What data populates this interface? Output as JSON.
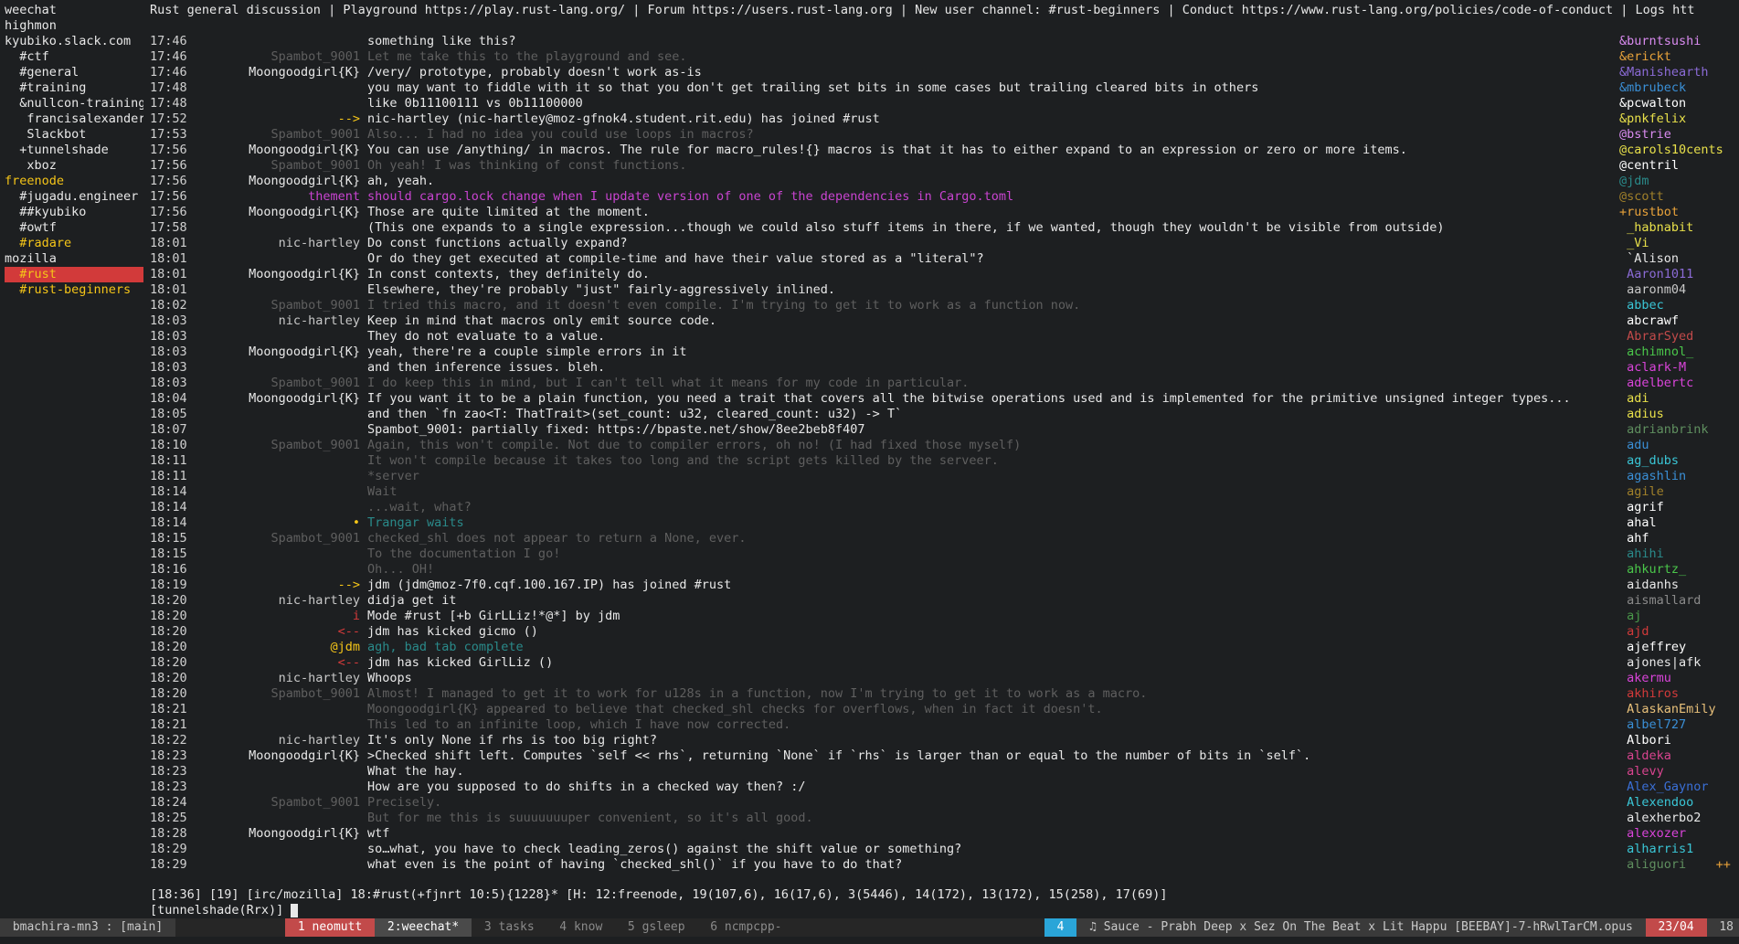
{
  "buflist": [
    {
      "text": "weechat",
      "color": "#e8e8e8",
      "sel": false
    },
    {
      "text": "highmon",
      "color": "#e8e8e8",
      "sel": false
    },
    {
      "text": "kyubiko.slack.com",
      "color": "#e8e8e8",
      "sel": false
    },
    {
      "text": "  #ctf",
      "color": "#e8e8e8",
      "sel": false
    },
    {
      "text": "  #general",
      "color": "#e8e8e8",
      "sel": false
    },
    {
      "text": "  #training",
      "color": "#e8e8e8",
      "sel": false
    },
    {
      "text": "  &nullcon-training",
      "color": "#e8e8e8",
      "sel": false
    },
    {
      "text": "   francisalexander",
      "color": "#e8e8e8",
      "sel": false
    },
    {
      "text": "   Slackbot",
      "color": "#e8e8e8",
      "sel": false
    },
    {
      "text": "  +tunnelshade",
      "color": "#e8e8e8",
      "sel": false
    },
    {
      "text": "   xboz",
      "color": "#e8e8e8",
      "sel": false
    },
    {
      "text": "freenode",
      "color": "#f5c518",
      "sel": false
    },
    {
      "text": "  #jugadu.engineer",
      "color": "#e8e8e8",
      "sel": false
    },
    {
      "text": "  ##kyubiko",
      "color": "#e8e8e8",
      "sel": false
    },
    {
      "text": "  #owtf",
      "color": "#e8e8e8",
      "sel": false
    },
    {
      "text": "  #radare",
      "color": "#f5c518",
      "sel": false
    },
    {
      "text": "mozilla",
      "color": "#e8e8e8",
      "sel": false
    },
    {
      "text": "  #rust",
      "color": "#f5c518",
      "sel": true
    },
    {
      "text": "  #rust-beginners",
      "color": "#f5c518",
      "sel": false
    }
  ],
  "topic": "Rust general discussion | Playground https://play.rust-lang.org/ | Forum https://users.rust-lang.org | New user channel: #rust-beginners | Conduct https://www.rust-lang.org/policies/code-of-conduct | Logs https://m>>",
  "chat": [
    {
      "ts": "17:46",
      "nick": "",
      "nc": "#e8e8e8",
      "msg": "something like this?",
      "mc": "#e8e8e8"
    },
    {
      "ts": "17:46",
      "nick": "Spambot_9001",
      "nc": "#5f5f5f",
      "msg": "Let me take this to the playground and see.",
      "mc": "#5f5f5f"
    },
    {
      "ts": "17:46",
      "nick": "Moongoodgirl{K}",
      "nc": "#e8e8e8",
      "msg": "/very/ prototype, probably doesn't work as-is",
      "mc": "#e8e8e8"
    },
    {
      "ts": "17:48",
      "nick": "",
      "nc": "#e8e8e8",
      "msg": "you may want to fiddle with it so that you don't get trailing set bits in some cases but trailing cleared bits in others",
      "mc": "#e8e8e8"
    },
    {
      "ts": "17:48",
      "nick": "",
      "nc": "#e8e8e8",
      "msg": "like 0b11100111 vs 0b11100000",
      "mc": "#e8e8e8"
    },
    {
      "ts": "17:52",
      "nick": "-->",
      "nc": "#f5c518",
      "msg": "nic-hartley (nic-hartley@moz-gfnok4.student.rit.edu) has joined #rust",
      "mc": "#e8e8e8"
    },
    {
      "ts": "17:53",
      "nick": "Spambot_9001",
      "nc": "#5f5f5f",
      "msg": "Also... I had no idea you could use loops in macros?",
      "mc": "#5f5f5f"
    },
    {
      "ts": "17:56",
      "nick": "Moongoodgirl{K}",
      "nc": "#e8e8e8",
      "msg": "You can use /anything/ in macros. The rule for macro_rules!{} macros is that it has to either expand to an expression or zero or more items.",
      "mc": "#e8e8e8"
    },
    {
      "ts": "17:56",
      "nick": "Spambot_9001",
      "nc": "#5f5f5f",
      "msg": "Oh yeah! I was thinking of const functions.",
      "mc": "#5f5f5f"
    },
    {
      "ts": "17:56",
      "nick": "Moongoodgirl{K}",
      "nc": "#e8e8e8",
      "msg": "ah, yeah.",
      "mc": "#e8e8e8"
    },
    {
      "ts": "17:56",
      "nick": "thement",
      "nc": "#c944d1",
      "msg": "should cargo.lock change when I update version of one of the dependencies in Cargo.toml",
      "mc": "#c944d1"
    },
    {
      "ts": "17:56",
      "nick": "Moongoodgirl{K}",
      "nc": "#e8e8e8",
      "msg": "Those are quite limited at the moment.",
      "mc": "#e8e8e8"
    },
    {
      "ts": "17:58",
      "nick": "",
      "nc": "#e8e8e8",
      "msg": "(This one expands to a single expression...though we could also stuff items in there, if we wanted, though they wouldn't be visible from outside)",
      "mc": "#e8e8e8"
    },
    {
      "ts": "18:01",
      "nick": "nic-hartley",
      "nc": "#c8c8c8",
      "msg": "Do const functions actually expand?",
      "mc": "#e8e8e8"
    },
    {
      "ts": "18:01",
      "nick": "",
      "nc": "#e8e8e8",
      "msg": "Or do they get executed at compile-time and have their value stored as a \"literal\"?",
      "mc": "#e8e8e8"
    },
    {
      "ts": "18:01",
      "nick": "Moongoodgirl{K}",
      "nc": "#e8e8e8",
      "msg": "In const contexts, they definitely do.",
      "mc": "#e8e8e8"
    },
    {
      "ts": "18:01",
      "nick": "",
      "nc": "#e8e8e8",
      "msg": "Elsewhere, they're probably \"just\" fairly-aggressively inlined.",
      "mc": "#e8e8e8"
    },
    {
      "ts": "18:02",
      "nick": "Spambot_9001",
      "nc": "#5f5f5f",
      "msg": "I tried this macro, and it doesn't even compile. I'm trying to get it to work as a function now.",
      "mc": "#5f5f5f"
    },
    {
      "ts": "18:03",
      "nick": "nic-hartley",
      "nc": "#c8c8c8",
      "msg": "Keep in mind that macros only emit source code.",
      "mc": "#e8e8e8"
    },
    {
      "ts": "18:03",
      "nick": "",
      "nc": "#e8e8e8",
      "msg": "They do not evaluate to a value.",
      "mc": "#e8e8e8"
    },
    {
      "ts": "18:03",
      "nick": "Moongoodgirl{K}",
      "nc": "#e8e8e8",
      "msg": "yeah, there're a couple simple errors in it",
      "mc": "#e8e8e8"
    },
    {
      "ts": "18:03",
      "nick": "",
      "nc": "#e8e8e8",
      "msg": "and then inference issues. bleh.",
      "mc": "#e8e8e8"
    },
    {
      "ts": "18:03",
      "nick": "Spambot_9001",
      "nc": "#5f5f5f",
      "msg": "I do keep this in mind, but I can't tell what it means for my code in particular.",
      "mc": "#5f5f5f"
    },
    {
      "ts": "18:04",
      "nick": "Moongoodgirl{K}",
      "nc": "#e8e8e8",
      "msg": "If you want it to be a plain function, you need a trait that covers all the bitwise operations used and is implemented for the primitive unsigned integer types...",
      "mc": "#e8e8e8"
    },
    {
      "ts": "18:05",
      "nick": "",
      "nc": "#e8e8e8",
      "msg": "and then `fn zao<T: ThatTrait>(set_count: u32, cleared_count: u32) -> T`",
      "mc": "#e8e8e8"
    },
    {
      "ts": "18:07",
      "nick": "",
      "nc": "#e8e8e8",
      "msg": "Spambot_9001: partially fixed: https://bpaste.net/show/8ee2beb8f407",
      "mc": "#e8e8e8"
    },
    {
      "ts": "18:10",
      "nick": "Spambot_9001",
      "nc": "#5f5f5f",
      "msg": "Again, this won't compile. Not due to compiler errors, oh no! (I had fixed those myself)",
      "mc": "#5f5f5f"
    },
    {
      "ts": "18:11",
      "nick": "",
      "nc": "#5f5f5f",
      "msg": "It won't compile because it takes too long and the script gets killed by the serveer.",
      "mc": "#5f5f5f"
    },
    {
      "ts": "18:11",
      "nick": "",
      "nc": "#5f5f5f",
      "msg": "*server",
      "mc": "#5f5f5f"
    },
    {
      "ts": "18:14",
      "nick": "",
      "nc": "#5f5f5f",
      "msg": "Wait",
      "mc": "#5f5f5f"
    },
    {
      "ts": "18:14",
      "nick": "",
      "nc": "#5f5f5f",
      "msg": "...wait, what?",
      "mc": "#5f5f5f"
    },
    {
      "ts": "18:14",
      "nick": "•",
      "nc": "#f5c518",
      "msg": "Trangar waits",
      "mc": "#2a8a8a"
    },
    {
      "ts": "18:15",
      "nick": "Spambot_9001",
      "nc": "#5f5f5f",
      "msg": "checked_shl does not appear to return a None, ever.",
      "mc": "#5f5f5f"
    },
    {
      "ts": "18:15",
      "nick": "",
      "nc": "#5f5f5f",
      "msg": "To the documentation I go!",
      "mc": "#5f5f5f"
    },
    {
      "ts": "18:16",
      "nick": "",
      "nc": "#5f5f5f",
      "msg": "Oh... OH!",
      "mc": "#5f5f5f"
    },
    {
      "ts": "18:19",
      "nick": "-->",
      "nc": "#f5c518",
      "msg": "jdm (jdm@moz-7f0.cqf.100.167.IP) has joined #rust",
      "mc": "#e8e8e8"
    },
    {
      "ts": "18:20",
      "nick": "nic-hartley",
      "nc": "#c8c8c8",
      "msg": "didja get it",
      "mc": "#e8e8e8"
    },
    {
      "ts": "18:20",
      "nick": "i",
      "nc": "#d23a3a",
      "msg": "Mode #rust [+b GirLLiz!*@*] by jdm",
      "mc": "#e8e8e8"
    },
    {
      "ts": "18:20",
      "nick": "<--",
      "nc": "#d23a3a",
      "msg": "jdm has kicked gicmo ()",
      "mc": "#e8e8e8"
    },
    {
      "ts": "18:20",
      "nick": "@jdm",
      "nc": "#f5c518",
      "msg": "agh, bad tab complete",
      "mc": "#2a8a8a"
    },
    {
      "ts": "18:20",
      "nick": "<--",
      "nc": "#d23a3a",
      "msg": "jdm has kicked GirlLiz ()",
      "mc": "#e8e8e8"
    },
    {
      "ts": "18:20",
      "nick": "nic-hartley",
      "nc": "#c8c8c8",
      "msg": "Whoops",
      "mc": "#e8e8e8"
    },
    {
      "ts": "18:20",
      "nick": "Spambot_9001",
      "nc": "#5f5f5f",
      "msg": "Almost! I managed to get it to work for u128s in a function, now I'm trying to get it to work as a macro.",
      "mc": "#5f5f5f"
    },
    {
      "ts": "18:21",
      "nick": "",
      "nc": "#5f5f5f",
      "msg": "Moongoodgirl{K} appeared to believe that checked_shl checks for overflows, when in fact it doesn't.",
      "mc": "#5f5f5f"
    },
    {
      "ts": "18:21",
      "nick": "",
      "nc": "#5f5f5f",
      "msg": "This led to an infinite loop, which I have now corrected.",
      "mc": "#5f5f5f"
    },
    {
      "ts": "18:22",
      "nick": "nic-hartley",
      "nc": "#c8c8c8",
      "msg": "It's only None if rhs is too big right?",
      "mc": "#e8e8e8"
    },
    {
      "ts": "18:23",
      "nick": "Moongoodgirl{K}",
      "nc": "#e8e8e8",
      "msg": ">Checked shift left. Computes `self << rhs`, returning `None` if `rhs` is larger than or equal to the number of bits in `self`.",
      "mc": "#e8e8e8"
    },
    {
      "ts": "18:23",
      "nick": "",
      "nc": "#e8e8e8",
      "msg": "What the hay.",
      "mc": "#e8e8e8"
    },
    {
      "ts": "18:23",
      "nick": "",
      "nc": "#e8e8e8",
      "msg": "How are you supposed to do shifts in a checked way then? :/",
      "mc": "#e8e8e8"
    },
    {
      "ts": "18:24",
      "nick": "Spambot_9001",
      "nc": "#5f5f5f",
      "msg": "Precisely.",
      "mc": "#5f5f5f"
    },
    {
      "ts": "18:25",
      "nick": "",
      "nc": "#5f5f5f",
      "msg": "But for me this is suuuuuuuper convenient, so it's all good.",
      "mc": "#5f5f5f"
    },
    {
      "ts": "18:28",
      "nick": "Moongoodgirl{K}",
      "nc": "#e8e8e8",
      "msg": "wtf",
      "mc": "#e8e8e8"
    },
    {
      "ts": "18:29",
      "nick": "",
      "nc": "#e8e8e8",
      "msg": "so…what, you have to check leading_zeros() against the shift value or something?",
      "mc": "#e8e8e8"
    },
    {
      "ts": "18:29",
      "nick": "",
      "nc": "#e8e8e8",
      "msg": "what even is the point of having `checked_shl()` if you have to do that?",
      "mc": "#e8e8e8"
    }
  ],
  "nicklist": [
    {
      "n": "&burntsushi",
      "c": "#d98bf0"
    },
    {
      "n": "&erickt",
      "c": "#e8a23a"
    },
    {
      "n": "&Manishearth",
      "c": "#8b6bd6"
    },
    {
      "n": "&mbrubeck",
      "c": "#3a8fd6"
    },
    {
      "n": "&pcwalton",
      "c": "#ffffff"
    },
    {
      "n": "&pnkfelix",
      "c": "#e8e04a"
    },
    {
      "n": "@bstrie",
      "c": "#d98bf0"
    },
    {
      "n": "@carols10cents",
      "c": "#e8e04a"
    },
    {
      "n": "@centril",
      "c": "#ffffff"
    },
    {
      "n": "@jdm",
      "c": "#2a8a8a"
    },
    {
      "n": "@scott",
      "c": "#a0802a"
    },
    {
      "n": "+rustbot",
      "c": "#e8a23a"
    },
    {
      "n": " _habnabit",
      "c": "#e8e04a"
    },
    {
      "n": " _Vi",
      "c": "#e8e04a"
    },
    {
      "n": " `Alison",
      "c": "#e8e8e8"
    },
    {
      "n": " Aaron1011",
      "c": "#8b6bd6"
    },
    {
      "n": " aaronm04",
      "c": "#c8c8c8"
    },
    {
      "n": " abbec",
      "c": "#3ac6d6"
    },
    {
      "n": " abcrawf",
      "c": "#ffffff"
    },
    {
      "n": " AbrarSyed",
      "c": "#c24a4a"
    },
    {
      "n": " achimnol_",
      "c": "#4ac64a"
    },
    {
      "n": " aclark-M",
      "c": "#d944d9"
    },
    {
      "n": " adelbertc",
      "c": "#d944d9"
    },
    {
      "n": " adi",
      "c": "#e8e04a"
    },
    {
      "n": " adius",
      "c": "#e8e04a"
    },
    {
      "n": " adrianbrink",
      "c": "#5f8f5f"
    },
    {
      "n": " adu",
      "c": "#3a8fd6"
    },
    {
      "n": " ag_dubs",
      "c": "#3ac6d6"
    },
    {
      "n": " agashlin",
      "c": "#3a8fd6"
    },
    {
      "n": " agile",
      "c": "#a0802a"
    },
    {
      "n": " agrif",
      "c": "#ffffff"
    },
    {
      "n": " ahal",
      "c": "#ffffff"
    },
    {
      "n": " ahf",
      "c": "#ffffff"
    },
    {
      "n": " ahihi",
      "c": "#2a8a8a"
    },
    {
      "n": " ahkurtz_",
      "c": "#4ac64a"
    },
    {
      "n": " aidanhs",
      "c": "#e8e8e8"
    },
    {
      "n": " aismallard",
      "c": "#8a8a8a"
    },
    {
      "n": " aj",
      "c": "#4a9a4a"
    },
    {
      "n": " ajd",
      "c": "#d23a3a"
    },
    {
      "n": " ajeffrey",
      "c": "#ffffff"
    },
    {
      "n": " ajones|afk",
      "c": "#e8e8e8"
    },
    {
      "n": " akermu",
      "c": "#d944d9"
    },
    {
      "n": " akhiros",
      "c": "#d23a3a"
    },
    {
      "n": " AlaskanEmily",
      "c": "#e8c07a"
    },
    {
      "n": " albel727",
      "c": "#3a8fd6"
    },
    {
      "n": " Albori",
      "c": "#ffffff"
    },
    {
      "n": " aldeka",
      "c": "#d9448f"
    },
    {
      "n": " alevy",
      "c": "#d9448f"
    },
    {
      "n": " Alex_Gaynor",
      "c": "#3a6fd6"
    },
    {
      "n": " Alexendoo",
      "c": "#3ac6d6"
    },
    {
      "n": " alexherbo2",
      "c": "#e8e8e8"
    },
    {
      "n": " alexozer",
      "c": "#d944d9"
    },
    {
      "n": " alharris1",
      "c": "#3ac6d6"
    },
    {
      "n": " aliguori",
      "c": "#5f8f5f"
    }
  ],
  "nicklist_more": "++",
  "status_bar": "[18:36] [19] [irc/mozilla] 18:#rust(+fjnrt 10:5){1228}* [H: 12:freenode, 19(107,6), 16(17,6), 3(5446), 14(172), 13(172), 15(258), 17(69)]",
  "input_line": "[tunnelshade(Rrx)] ",
  "tmux": {
    "host": " bmachira-mn3 : [main] ",
    "windows": [
      {
        "label": " 1 neomutt ",
        "cls": "pink"
      },
      {
        "label": " 2:weechat* ",
        "cls": "cur"
      },
      {
        "label": " 3 tasks ",
        "cls": ""
      },
      {
        "label": " 4 know ",
        "cls": ""
      },
      {
        "label": " 5 gsleep ",
        "cls": ""
      },
      {
        "label": " 6 ncmpcpp- ",
        "cls": ""
      }
    ],
    "right_badge": " 4 ",
    "song": " ♫ Sauce - Prabh Deep x Sez On The Beat x Lit Happu [BEEBAY]-7-hRwlTarCM.opus ",
    "date": " 23/04 ",
    "clock": " 18"
  }
}
